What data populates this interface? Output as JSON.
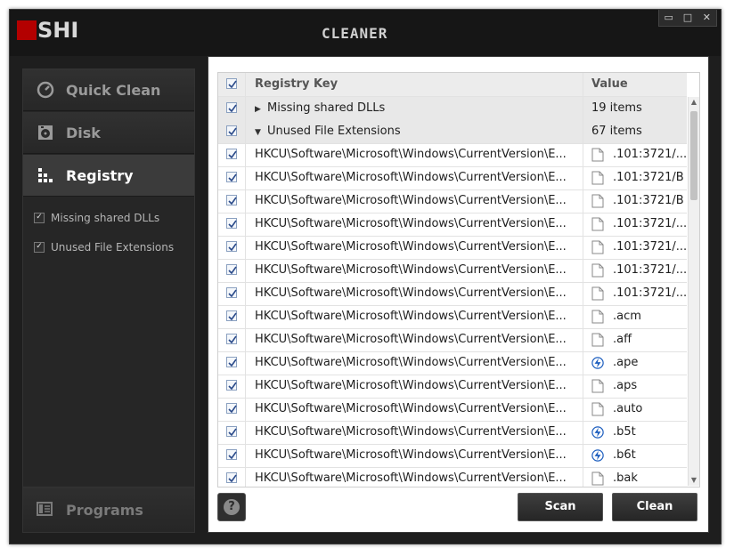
{
  "app": {
    "logo": "OSHI",
    "title": "CLEANER"
  },
  "window_controls": {
    "minimize": "▭",
    "maximize": "□",
    "close": "✕"
  },
  "sidebar": {
    "items": [
      {
        "label": "Quick Clean",
        "icon": "gauge-icon",
        "active": false
      },
      {
        "label": "Disk",
        "icon": "disk-icon",
        "active": false
      },
      {
        "label": "Registry",
        "icon": "registry-icon",
        "active": true
      }
    ],
    "subitems": [
      {
        "label": "Missing shared DLLs",
        "checked": true
      },
      {
        "label": "Unused File Extensions",
        "checked": true
      }
    ],
    "bottom": {
      "label": "Programs",
      "icon": "programs-icon"
    }
  },
  "grid": {
    "columns": [
      "Registry Key",
      "Value"
    ],
    "groups": [
      {
        "label": "Missing shared DLLs",
        "value": "19 items",
        "expanded": false
      },
      {
        "label": "Unused File Extensions",
        "value": "67 items",
        "expanded": true
      }
    ],
    "rows": [
      {
        "key": "HKCU\\Software\\Microsoft\\Windows\\CurrentVersion\\E...",
        "value": ".101:3721/...",
        "icon": "file-icon"
      },
      {
        "key": "HKCU\\Software\\Microsoft\\Windows\\CurrentVersion\\E...",
        "value": ".101:3721/B",
        "icon": "file-icon"
      },
      {
        "key": "HKCU\\Software\\Microsoft\\Windows\\CurrentVersion\\E...",
        "value": ".101:3721/B",
        "icon": "file-icon"
      },
      {
        "key": "HKCU\\Software\\Microsoft\\Windows\\CurrentVersion\\E...",
        "value": ".101:3721/...",
        "icon": "file-icon"
      },
      {
        "key": "HKCU\\Software\\Microsoft\\Windows\\CurrentVersion\\E...",
        "value": ".101:3721/...",
        "icon": "file-icon"
      },
      {
        "key": "HKCU\\Software\\Microsoft\\Windows\\CurrentVersion\\E...",
        "value": ".101:3721/...",
        "icon": "file-icon"
      },
      {
        "key": "HKCU\\Software\\Microsoft\\Windows\\CurrentVersion\\E...",
        "value": ".101:3721/...",
        "icon": "file-icon"
      },
      {
        "key": "HKCU\\Software\\Microsoft\\Windows\\CurrentVersion\\E...",
        "value": ".acm",
        "icon": "file-icon"
      },
      {
        "key": "HKCU\\Software\\Microsoft\\Windows\\CurrentVersion\\E...",
        "value": ".aff",
        "icon": "file-icon"
      },
      {
        "key": "HKCU\\Software\\Microsoft\\Windows\\CurrentVersion\\E...",
        "value": ".ape",
        "icon": "lightning-icon"
      },
      {
        "key": "HKCU\\Software\\Microsoft\\Windows\\CurrentVersion\\E...",
        "value": ".aps",
        "icon": "file-icon"
      },
      {
        "key": "HKCU\\Software\\Microsoft\\Windows\\CurrentVersion\\E...",
        "value": ".auto",
        "icon": "file-icon"
      },
      {
        "key": "HKCU\\Software\\Microsoft\\Windows\\CurrentVersion\\E...",
        "value": ".b5t",
        "icon": "lightning-icon"
      },
      {
        "key": "HKCU\\Software\\Microsoft\\Windows\\CurrentVersion\\E...",
        "value": ".b6t",
        "icon": "lightning-icon"
      },
      {
        "key": "HKCU\\Software\\Microsoft\\Windows\\CurrentVersion\\E...",
        "value": ".bak",
        "icon": "file-icon"
      }
    ]
  },
  "buttons": {
    "help": "?",
    "scan": "Scan",
    "clean": "Clean"
  },
  "colors": {
    "accent_red": "#b30000",
    "window_bg": "#1e1e1e",
    "active_nav": "#3b3b3b"
  }
}
